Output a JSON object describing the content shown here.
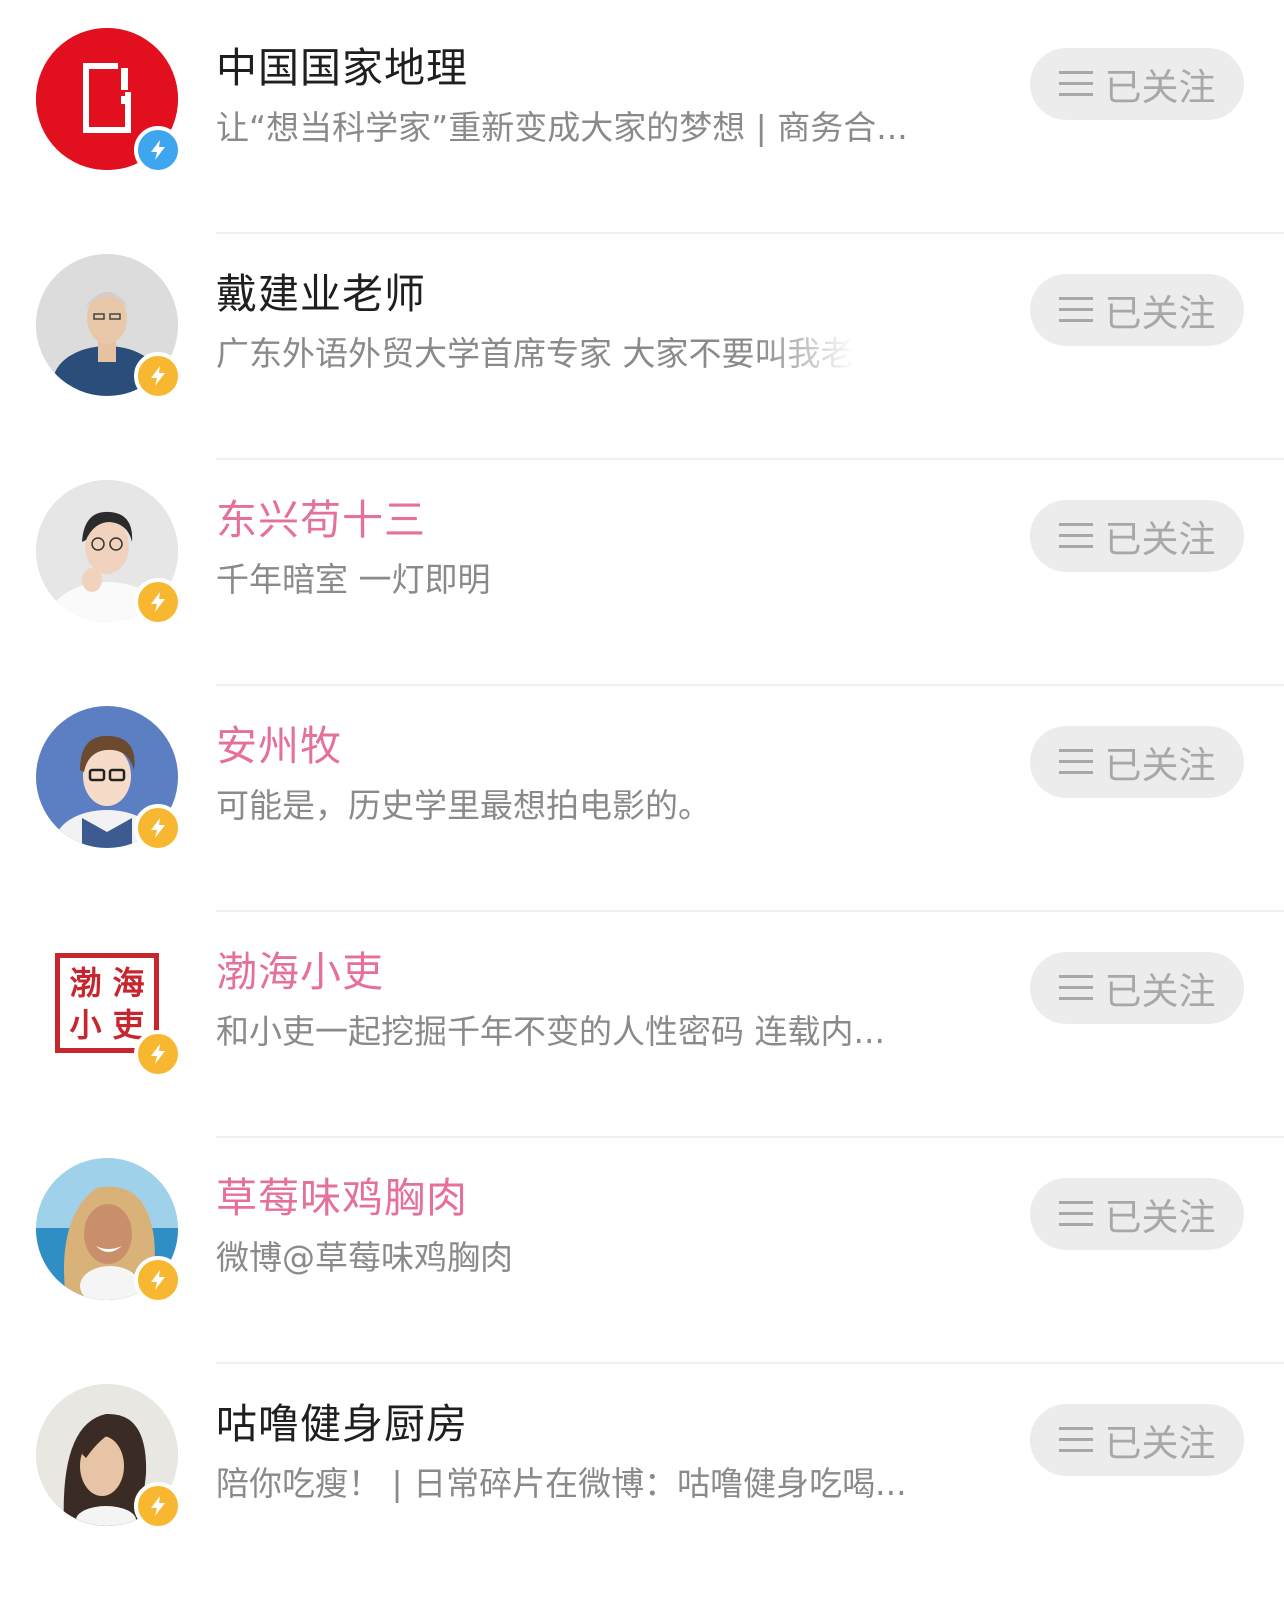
{
  "follow_label": "已关注",
  "colors": {
    "name_default": "#1f1f1f",
    "name_highlight": "#e5709c",
    "bio": "#8a8a8a",
    "button_bg": "#ececec",
    "button_text": "#a8a8a8",
    "badge_blue": "#3ea6ee",
    "badge_yellow": "#f7b731"
  },
  "users": [
    {
      "name": "中国国家地理",
      "bio": "让“想当科学家”重新变成大家的梦想 | 商务合...",
      "badge": "blue"
    },
    {
      "name": "戴建业老师",
      "bio": "广东外语外贸大学首席专家 大家不要叫我老",
      "badge": "yellow"
    },
    {
      "name": "东兴苟十三",
      "bio": "千年暗室 一灯即明",
      "badge": "yellow"
    },
    {
      "name": "安州牧",
      "bio": "可能是，历史学里最想拍电影的。",
      "badge": "yellow"
    },
    {
      "name": "渤海小吏",
      "bio": "和小吏一起挖掘千年不变的人性密码 连载内...",
      "badge": "yellow",
      "avatar_text": [
        "渤",
        "海",
        "小",
        "吏"
      ]
    },
    {
      "name": "草莓味鸡胸肉",
      "bio": "微博@草莓味鸡胸肉",
      "badge": "yellow"
    },
    {
      "name": "咕噜健身厨房",
      "bio": "陪你吃瘦！ | 日常碎片在微博：咕噜健身吃喝...",
      "badge": "yellow"
    }
  ]
}
